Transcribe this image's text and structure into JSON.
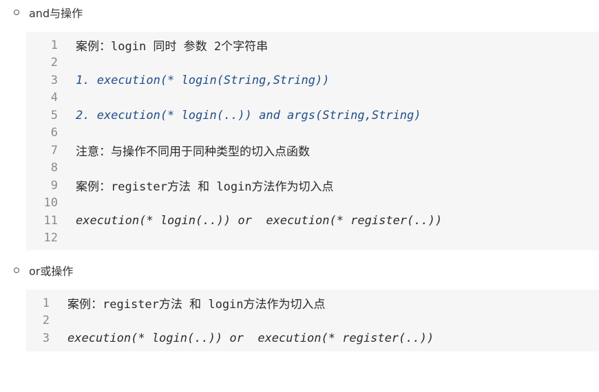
{
  "sections": [
    {
      "label": "and与操作",
      "lines": [
        "案例：login 同时 参数 2个字符串",
        "",
        "1. execution(* login(String,String))",
        "",
        "2. execution(* login(..)) and args(String,String)",
        "",
        "注意：与操作不同用于同种类型的切入点函数",
        "",
        "案例：register方法 和 login方法作为切入点",
        "",
        "execution(* login(..)) or  execution(* register(..))",
        ""
      ]
    },
    {
      "label": "or或操作",
      "lines": [
        "案例：register方法 和 login方法作为切入点",
        "",
        "execution(* login(..)) or  execution(* register(..))"
      ]
    }
  ],
  "line_numbers_1": [
    "1",
    "2",
    "3",
    "4",
    "5",
    "6",
    "7",
    "8",
    "9",
    "10",
    "11",
    "12"
  ],
  "line_numbers_2": [
    "1",
    "2",
    "3"
  ]
}
